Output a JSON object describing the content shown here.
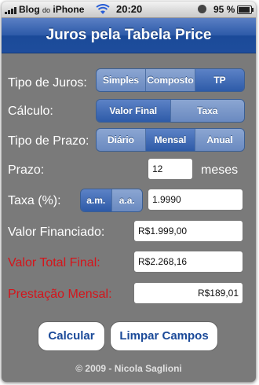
{
  "status": {
    "carrier": "Blog",
    "carrier_small": "do",
    "device": "iPhone",
    "time": "20:20",
    "battery": "95 %",
    "battery_level": 0.95
  },
  "app": {
    "title": "Juros pela Tabela Price"
  },
  "tipo_juros": {
    "label": "Tipo de Juros:",
    "options": [
      "Simples",
      "Composto",
      "TP"
    ],
    "selected": "TP"
  },
  "calculo": {
    "label": "Cálculo:",
    "options": [
      "Valor Final",
      "Taxa"
    ],
    "selected": "Valor Final"
  },
  "tipo_prazo": {
    "label": "Tipo de Prazo:",
    "options": [
      "Diário",
      "Mensal",
      "Anual"
    ],
    "selected": "Mensal"
  },
  "prazo": {
    "label": "Prazo:",
    "value": "12",
    "unit": "meses"
  },
  "taxa": {
    "label": "Taxa (%):",
    "options": [
      "a.m.",
      "a.a."
    ],
    "selected": "a.m.",
    "value": "1.9990"
  },
  "valor_financiado": {
    "label": "Valor Financiado:",
    "value": "R$1.999,00"
  },
  "valor_total_final": {
    "label": "Valor Total Final:",
    "value": "R$2.268,16"
  },
  "prestacao_mensal": {
    "label": "Prestação Mensal:",
    "value": "R$189,01"
  },
  "buttons": {
    "calcular": "Calcular",
    "limpar": "Limpar Campos"
  },
  "footer": "© 2009 - Nicola Saglioni",
  "colors": {
    "accent": "#1b4a99",
    "label_red": "#d4151b",
    "background": "#7a7a7a"
  }
}
